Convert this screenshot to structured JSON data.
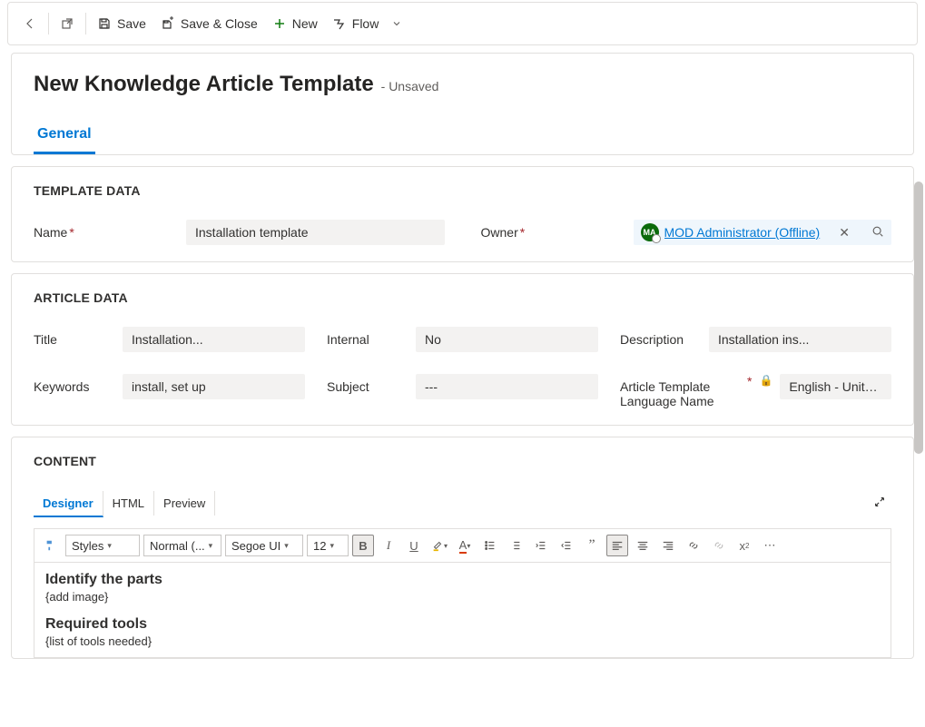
{
  "toolbar": {
    "save": "Save",
    "save_close": "Save & Close",
    "new": "New",
    "flow": "Flow"
  },
  "header": {
    "title": "New Knowledge Article Template",
    "status": "- Unsaved"
  },
  "tabs": {
    "general": "General"
  },
  "template_section": {
    "title": "TEMPLATE DATA",
    "name_label": "Name",
    "name_value": "Installation template",
    "owner_label": "Owner",
    "owner_value": "MOD Administrator (Offline)",
    "owner_initials": "MA"
  },
  "article_section": {
    "title": "ARTICLE DATA",
    "title_label": "Title",
    "title_value": "Installation...",
    "internal_label": "Internal",
    "internal_value": "No",
    "description_label": "Description",
    "description_value": "Installation ins...",
    "keywords_label": "Keywords",
    "keywords_value": "install, set up",
    "subject_label": "Subject",
    "subject_value": "---",
    "lang_label": "Article Template Language Name",
    "lang_value": "English - Unite..."
  },
  "content_section": {
    "title": "CONTENT",
    "tab_designer": "Designer",
    "tab_html": "HTML",
    "tab_preview": "Preview",
    "toolbar": {
      "styles": "Styles",
      "format": "Normal (...",
      "font": "Segoe UI",
      "size": "12"
    },
    "body": {
      "h1": "Identify the parts",
      "p1": "{add image}",
      "h2": "Required tools",
      "p2": "{list of tools needed}"
    }
  }
}
